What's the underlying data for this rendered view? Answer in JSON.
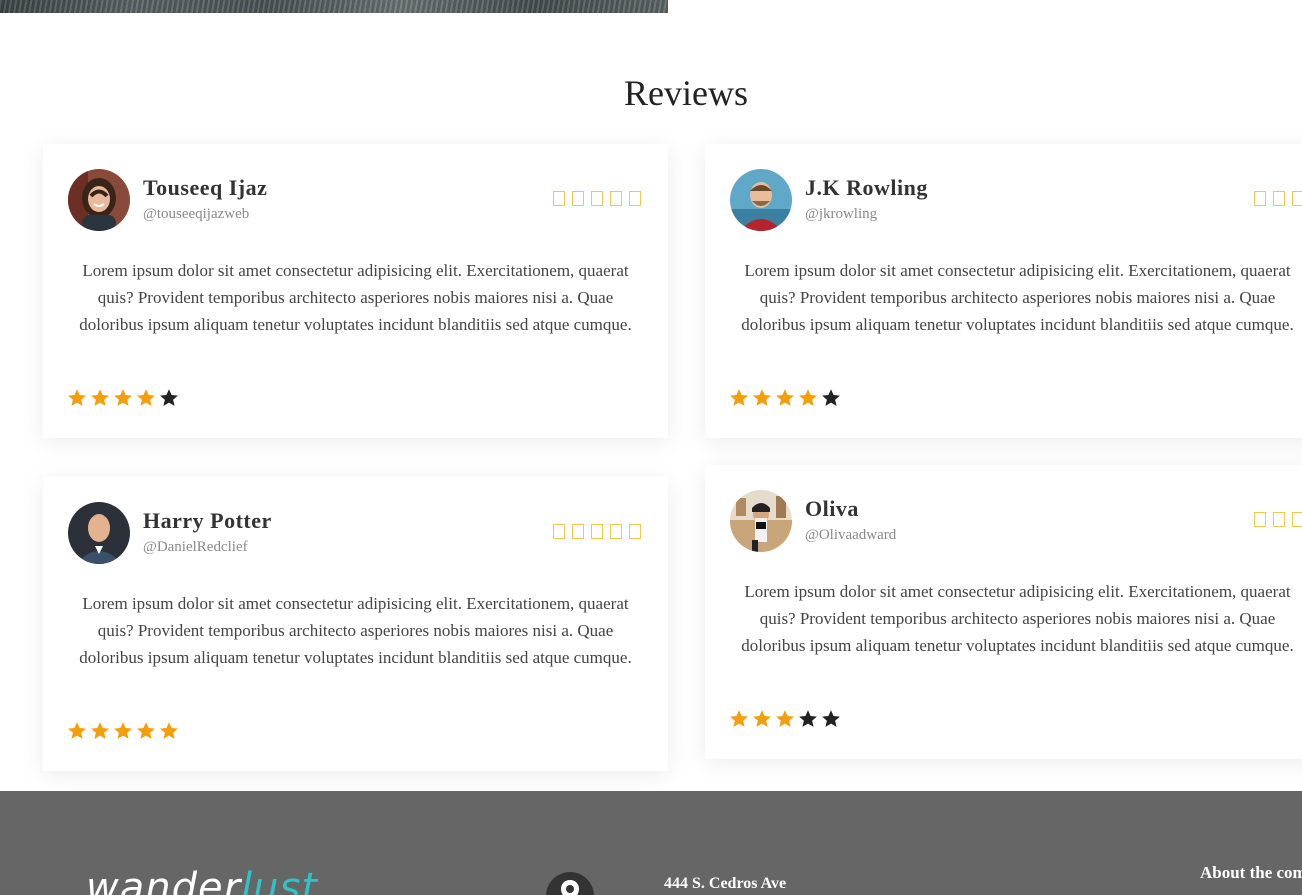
{
  "section_title": "Reviews",
  "accent_star_color": "#f59e0b",
  "empty_star_color": "#222222",
  "reviews": [
    {
      "name": "Touseeq Ijaz",
      "handle": "@touseeqijazweb",
      "text": "Lorem ipsum dolor sit amet consectetur adipisicing elit. Exercitationem, quaerat quis? Provident temporibus architecto asperiores nobis maiores nisi a. Quae doloribus ipsum aliquam tenetur voluptates incidunt blanditiis sed atque cumque.",
      "rating": 4,
      "avatar_icon": "woman-avatar"
    },
    {
      "name": "J.K Rowling",
      "handle": "@jkrowling",
      "text": "Lorem ipsum dolor sit amet consectetur adipisicing elit. Exercitationem, quaerat quis? Provident temporibus architecto asperiores nobis maiores nisi a. Quae doloribus ipsum aliquam tenetur voluptates incidunt blanditiis sed atque cumque.",
      "rating": 4,
      "avatar_icon": "man-avatar"
    },
    {
      "name": "Harry Potter",
      "handle": "@DanielRedclief",
      "text": "Lorem ipsum dolor sit amet consectetur adipisicing elit. Exercitationem, quaerat quis? Provident temporibus architecto asperiores nobis maiores nisi a. Quae doloribus ipsum aliquam tenetur voluptates incidunt blanditiis sed atque cumque.",
      "rating": 5,
      "avatar_icon": "man-avatar"
    },
    {
      "name": "Oliva",
      "handle": "@Olivaadward",
      "text": "Lorem ipsum dolor sit amet consectetur adipisicing elit. Exercitationem, quaerat quis? Provident temporibus architecto asperiores nobis maiores nisi a. Quae doloribus ipsum aliquam tenetur voluptates incidunt blanditiis sed atque cumque.",
      "rating": 3,
      "avatar_icon": "woman-camera-avatar"
    }
  ],
  "footer": {
    "logo_main": "wander",
    "logo_accent": "lust",
    "address": "444 S. Cedros Ave",
    "about_heading": "About the company"
  }
}
